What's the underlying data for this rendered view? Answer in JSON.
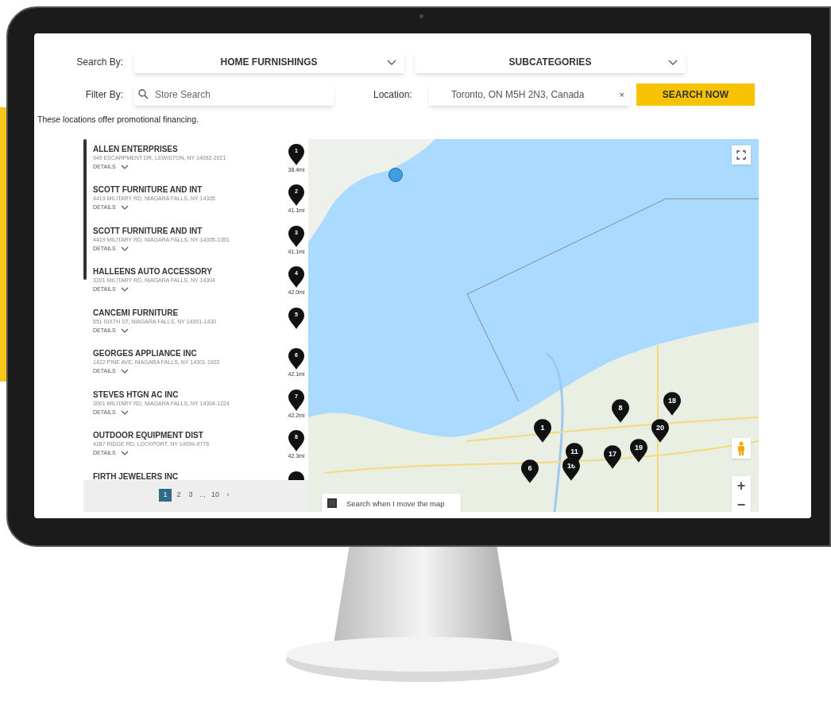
{
  "search_by": {
    "label": "Search By:",
    "category": "HOME FURNISHINGS",
    "subcategory": "SUBCATEGORIES"
  },
  "filter_by": {
    "label": "Filter By:",
    "placeholder": "Store Search"
  },
  "location": {
    "label": "Location:",
    "value": "Toronto, ON M5H 2N3, Canada",
    "clear": "×"
  },
  "search_button": "SEARCH NOW",
  "notice": "These locations offer promotional financing.",
  "stores": [
    {
      "pin": "1",
      "name": "ALLEN ENTERPRISES",
      "address": "949 ESCARPMENT DR, LEWISTON, NY 14092-2021",
      "details": "DETAILS",
      "distance": "38.4mi"
    },
    {
      "pin": "2",
      "name": "SCOTT FURNITURE AND INT",
      "address": "4419 MILITARY RD, NIAGARA FALLS, NY 14305",
      "details": "DETAILS",
      "distance": "41.1mi"
    },
    {
      "pin": "3",
      "name": "SCOTT FURNITURE AND INT",
      "address": "4419 MILITARY RD, NIAGARA FALLS, NY 14305-1351",
      "details": "DETAILS",
      "distance": "41.1mi"
    },
    {
      "pin": "4",
      "name": "HALLEENS AUTO ACCESSORY",
      "address": "3201 MILITARY RD, NIAGARA FALLS, NY 14304",
      "details": "DETAILS",
      "distance": "42.0mi"
    },
    {
      "pin": "5",
      "name": "CANCEMI FURNITURE",
      "address": "551 SIXTH ST, NIAGARA FALLS, NY 14301-1430",
      "details": "DETAILS"
    },
    {
      "pin": "6",
      "name": "GEORGES APPLIANCE INC",
      "address": "1422 PINE AVE, NIAGARA FALLS, NY 14301-1922",
      "details": "DETAILS",
      "distance": "42.1mi"
    },
    {
      "pin": "7",
      "name": "STEVES HTGN AC INC",
      "address": "3001 MILITARY RD, NIAGARA FALLS, NY 14304-1224",
      "details": "DETAILS",
      "distance": "42.2mi"
    },
    {
      "pin": "8",
      "name": "OUTDOOR EQUIPMENT DIST",
      "address": "4287 RIDGE RD, LOCKPORT, NY 14094-9776",
      "details": "DETAILS",
      "distance": "42.3mi"
    },
    {
      "name": "FIRTH JEWELERS INC"
    }
  ],
  "pagination": [
    {
      "label": "1",
      "selected": true
    },
    {
      "label": "2",
      "selected": false
    },
    {
      "label": "3",
      "selected": false
    },
    {
      "label": "...",
      "selected": false
    },
    {
      "label": "10",
      "selected": false
    },
    {
      "label": "›",
      "selected": false
    }
  ],
  "map": {
    "markers": [
      "6",
      "16",
      "11",
      "17",
      "19",
      "20",
      "18",
      "8",
      "1"
    ],
    "search_on_move": {
      "label": "Search when I move the map",
      "checked": false
    },
    "zoom_in": "+",
    "zoom_out": "−"
  }
}
